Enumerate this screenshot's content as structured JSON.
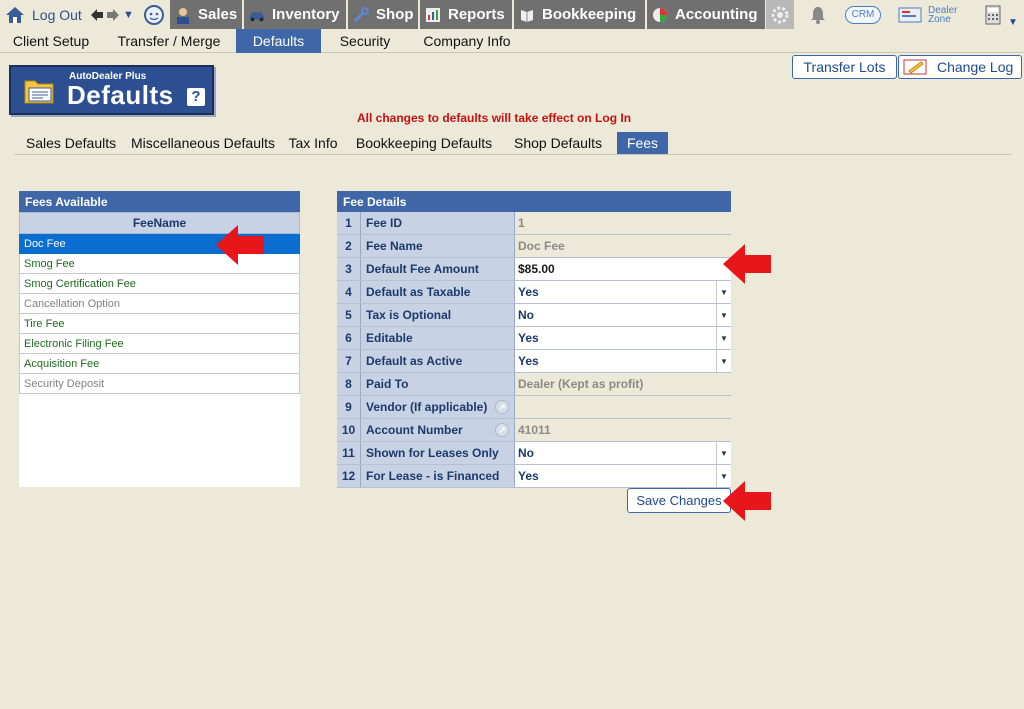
{
  "toolbar": {
    "logout": "Log Out",
    "sales": "Sales",
    "inventory": "Inventory",
    "shop": "Shop",
    "reports": "Reports",
    "bookkeeping": "Bookkeeping",
    "accounting": "Accounting",
    "crm": "CRM",
    "dealer_zone_line1": "Dealer",
    "dealer_zone_line2": "Zone"
  },
  "subnav": {
    "items": [
      "Client Setup",
      "Transfer / Merge",
      "Defaults",
      "Security",
      "Company Info"
    ],
    "active": "Defaults"
  },
  "logo": {
    "subtitle": "AutoDealer Plus",
    "title": "Defaults",
    "help": "?"
  },
  "buttons": {
    "transfer_lots": "Transfer Lots",
    "change_log": "Change Log",
    "save_changes": "Save Changes"
  },
  "notice": "All changes to defaults will take effect on Log In",
  "tabs": {
    "items": [
      "Sales Defaults",
      "Miscellaneous Defaults",
      "Tax Info",
      "Bookkeeping Defaults",
      "Shop Defaults",
      "Fees"
    ],
    "active": "Fees"
  },
  "fees_available": {
    "title": "Fees Available",
    "column": "FeeName",
    "rows": [
      {
        "name": "Doc Fee",
        "state": "selected"
      },
      {
        "name": "Smog Fee",
        "state": "active"
      },
      {
        "name": "Smog Certification Fee",
        "state": "active"
      },
      {
        "name": "Cancellation Option",
        "state": "inactive"
      },
      {
        "name": "Tire Fee",
        "state": "active"
      },
      {
        "name": "Electronic Filing Fee",
        "state": "active"
      },
      {
        "name": "Acquisition Fee",
        "state": "active"
      },
      {
        "name": "Security Deposit",
        "state": "inactive"
      }
    ]
  },
  "fee_details": {
    "title": "Fee Details",
    "rows": [
      {
        "num": "1",
        "label": "Fee ID",
        "value": "1",
        "kind": "readonly"
      },
      {
        "num": "2",
        "label": "Fee Name",
        "value": "Doc Fee",
        "kind": "readonly"
      },
      {
        "num": "3",
        "label": "Default Fee Amount",
        "value": "$85.00",
        "kind": "edit"
      },
      {
        "num": "4",
        "label": "Default as Taxable",
        "value": "Yes",
        "kind": "select"
      },
      {
        "num": "5",
        "label": "Tax is Optional",
        "value": "No",
        "kind": "select"
      },
      {
        "num": "6",
        "label": "Editable",
        "value": "Yes",
        "kind": "select"
      },
      {
        "num": "7",
        "label": "Default as Active",
        "value": "Yes",
        "kind": "select"
      },
      {
        "num": "8",
        "label": "Paid To",
        "value": "Dealer (Kept as profit)",
        "kind": "readonly"
      },
      {
        "num": "9",
        "label": "Vendor (If applicable)",
        "value": "",
        "kind": "readonly",
        "icon": true
      },
      {
        "num": "10",
        "label": "Account Number",
        "value": "41011",
        "kind": "readonly",
        "icon": true
      },
      {
        "num": "11",
        "label": "Shown for Leases Only",
        "value": "No",
        "kind": "select"
      },
      {
        "num": "12",
        "label": "For Lease - is Financed",
        "value": "Yes",
        "kind": "select"
      }
    ]
  },
  "colors": {
    "accent": "#3f67a7",
    "selected_row": "#0a6ed1",
    "notice": "#c81010",
    "arrow": "#e8151b",
    "background": "#ece9d8"
  }
}
